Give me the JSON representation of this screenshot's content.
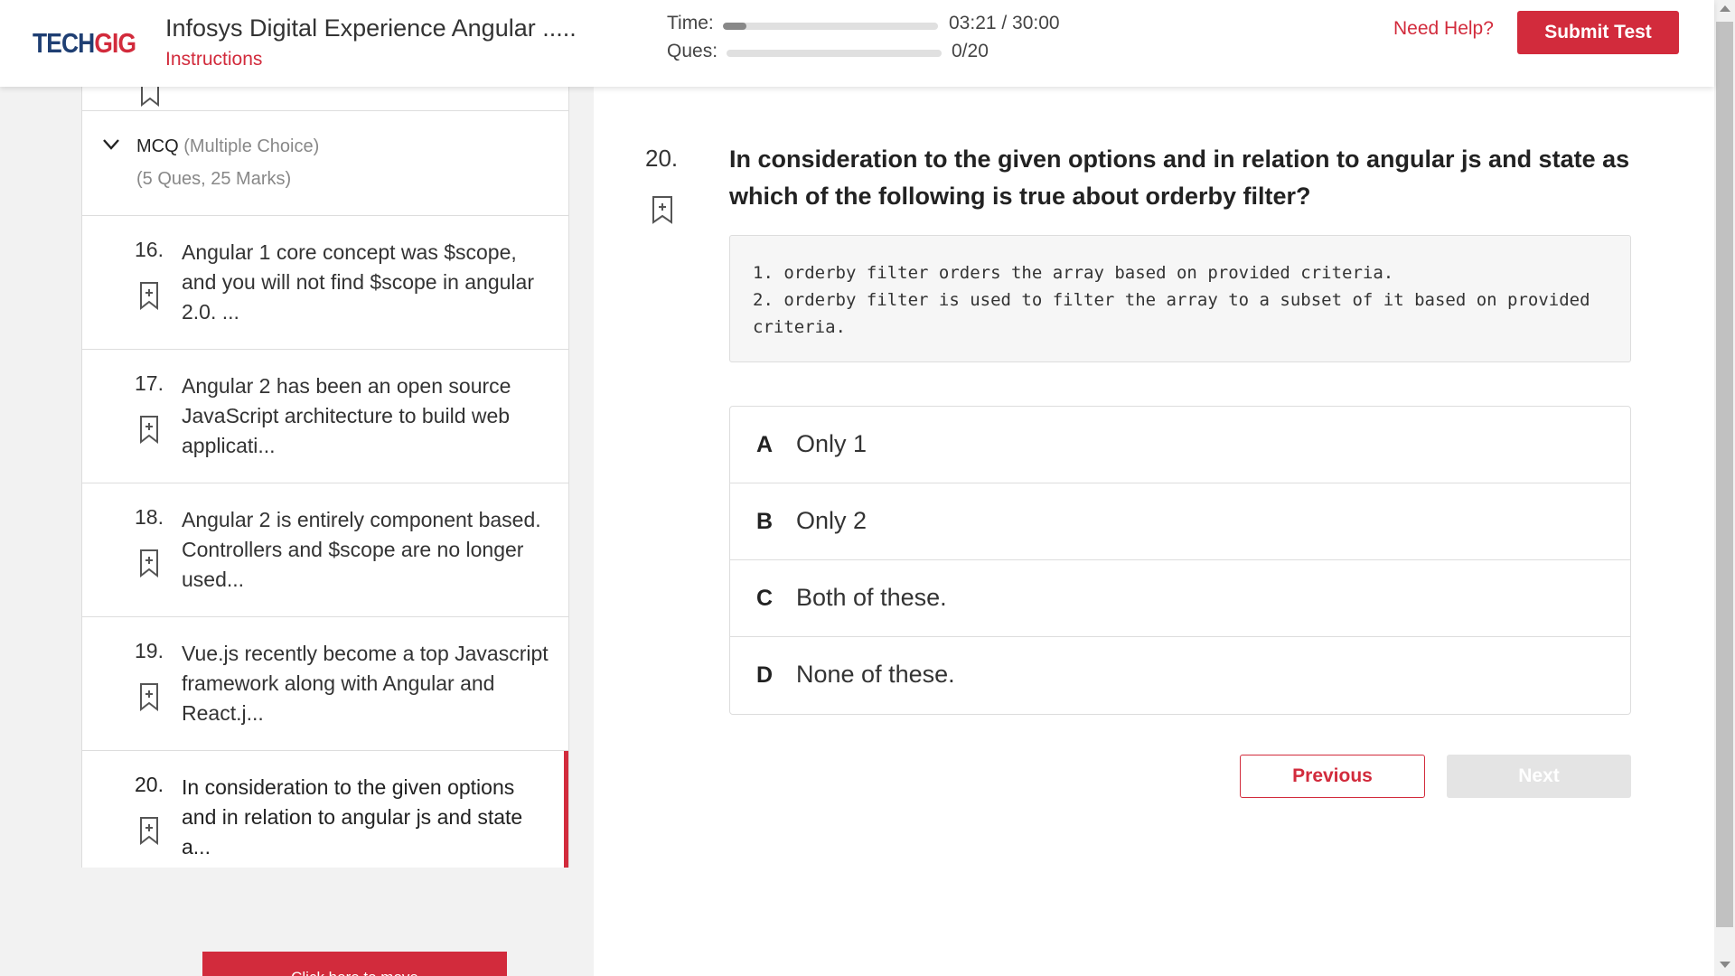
{
  "header": {
    "logo_part1": "TECH",
    "logo_part2": "GIG",
    "test_title": "Infosys Digital Experience Angular .....",
    "instructions_label": "Instructions",
    "time_label": "Time:",
    "time_value": "03:21 / 30:00",
    "time_progress": 0.11,
    "ques_label": "Ques:",
    "ques_value": "0/20",
    "ques_progress": 0,
    "need_help": "Need Help?",
    "submit_label": "Submit Test"
  },
  "sidebar": {
    "section": {
      "name": "MCQ",
      "subtitle": "(Multiple Choice)",
      "meta": "(5 Ques, 25 Marks)"
    },
    "questions": [
      {
        "num": "16.",
        "text": "Angular 1 core concept was $scope, and you will not find $scope in angular 2.0. ..."
      },
      {
        "num": "17.",
        "text": "Angular 2 has been an open source JavaScript architecture to build web applicati..."
      },
      {
        "num": "18.",
        "text": "Angular 2 is entirely component based. Controllers and $scope are no longer used..."
      },
      {
        "num": "19.",
        "text": "Vue.js recently become a top Javascript framework along with Angular and React.j..."
      },
      {
        "num": "20.",
        "text": "In consideration to the given options and in relation to angular js and state a..."
      }
    ],
    "move_button": "Click here to move"
  },
  "main": {
    "question_number": "20.",
    "question_text": "In consideration to the given options and in relation to angular js and state as which of the following is true about orderby filter?",
    "code_lines": [
      "1. orderby filter orders the array based on provided criteria.",
      "2. orderby filter is used to filter the array to a subset of it based on provided criteria."
    ],
    "options": [
      {
        "letter": "A",
        "text": "Only 1"
      },
      {
        "letter": "B",
        "text": "Only 2"
      },
      {
        "letter": "C",
        "text": "Both of these."
      },
      {
        "letter": "D",
        "text": "None of these."
      }
    ],
    "previous_label": "Previous",
    "next_label": "Next"
  },
  "colors": {
    "accent": "#d22b3c",
    "logo_dark": "#1f3f73"
  }
}
